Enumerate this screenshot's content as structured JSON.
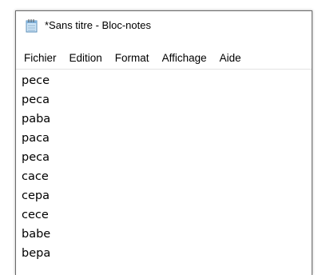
{
  "window": {
    "title": "*Sans titre - Bloc-notes",
    "icon": "notepad-icon"
  },
  "menu": {
    "items": [
      "Fichier",
      "Edition",
      "Format",
      "Affichage",
      "Aide"
    ]
  },
  "editor": {
    "lines": [
      "pece",
      "peca",
      "paba",
      "paca",
      "peca",
      "cace",
      "cepa",
      "cece",
      "babe",
      "bepa"
    ]
  },
  "colors": {
    "background": "#ffffff",
    "text": "#000000",
    "border": "#6a6a6a"
  }
}
